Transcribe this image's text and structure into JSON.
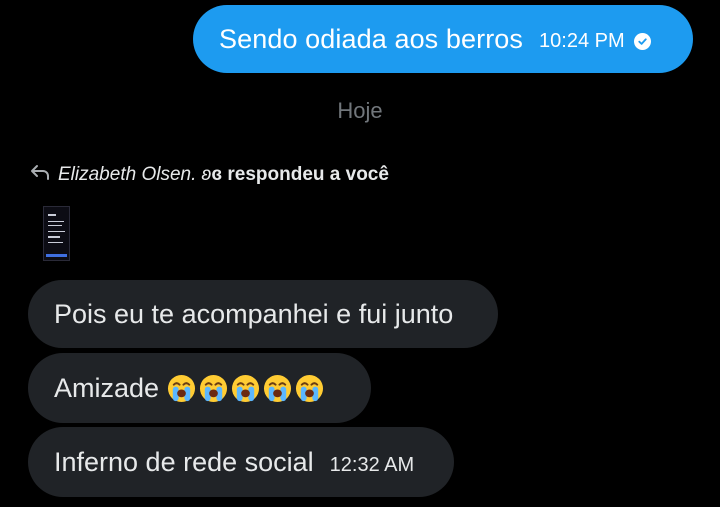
{
  "sent_message": {
    "text": "Sendo odiada aos berros",
    "time": "10:24 PM",
    "status_icon": "read-check-icon"
  },
  "date_separator": "Hoje",
  "reply_header": {
    "icon": "reply-arrow-icon",
    "name": "Elizabeth Olsen. ʚ",
    "rest": "ɞ respondeu a você"
  },
  "attachment": {
    "icon": "media-thumbnail"
  },
  "received_messages": [
    {
      "text": "Pois eu te acompanhei e fui junto"
    },
    {
      "text": "Amizade",
      "emoji": "loudly-crying-face",
      "emoji_count": 5
    },
    {
      "text": "Inferno de rede social",
      "time": "12:32 AM"
    }
  ],
  "colors": {
    "sent_bubble": "#1d9bf0",
    "received_bubble": "#202327",
    "background": "#000000",
    "muted_text": "#71767b"
  }
}
